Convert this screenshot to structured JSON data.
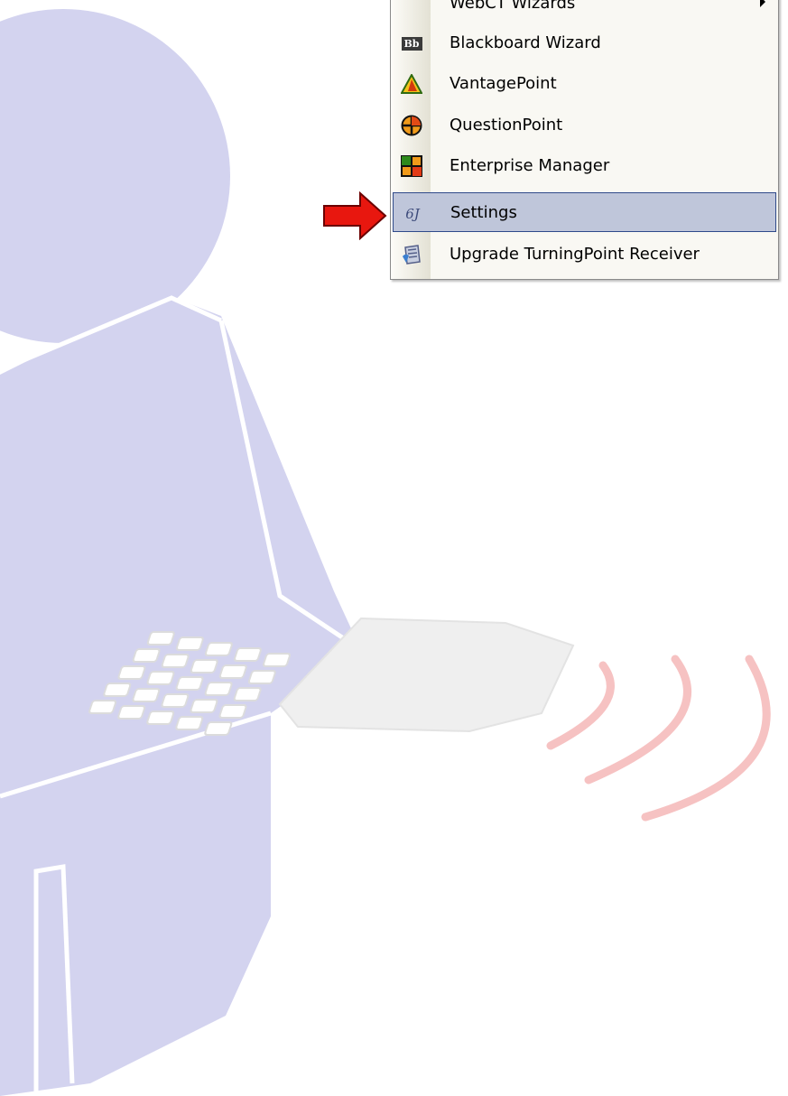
{
  "menu": {
    "items": [
      {
        "label": "WebCT Wizards",
        "icon": "webct-icon",
        "has_submenu": true
      },
      {
        "label": "Blackboard Wizard",
        "icon": "blackboard-icon",
        "badge": "Bb"
      },
      {
        "label": "VantagePoint",
        "icon": "vantagepoint-icon"
      },
      {
        "label": "QuestionPoint",
        "icon": "questionpoint-icon"
      },
      {
        "label": "Enterprise Manager",
        "icon": "enterprise-manager-icon"
      },
      {
        "label": "Settings",
        "icon": "settings-icon",
        "badge": "6J",
        "selected": true
      },
      {
        "label": "Upgrade TurningPoint Receiver",
        "icon": "receiver-upgrade-icon"
      }
    ]
  },
  "colors": {
    "figure": "#d3d3ef",
    "selection": "#bfc6da",
    "selection_border": "#2f4a8a",
    "pointer_arrow": "#e8170f",
    "signal_waves": "#f4b8b8"
  }
}
